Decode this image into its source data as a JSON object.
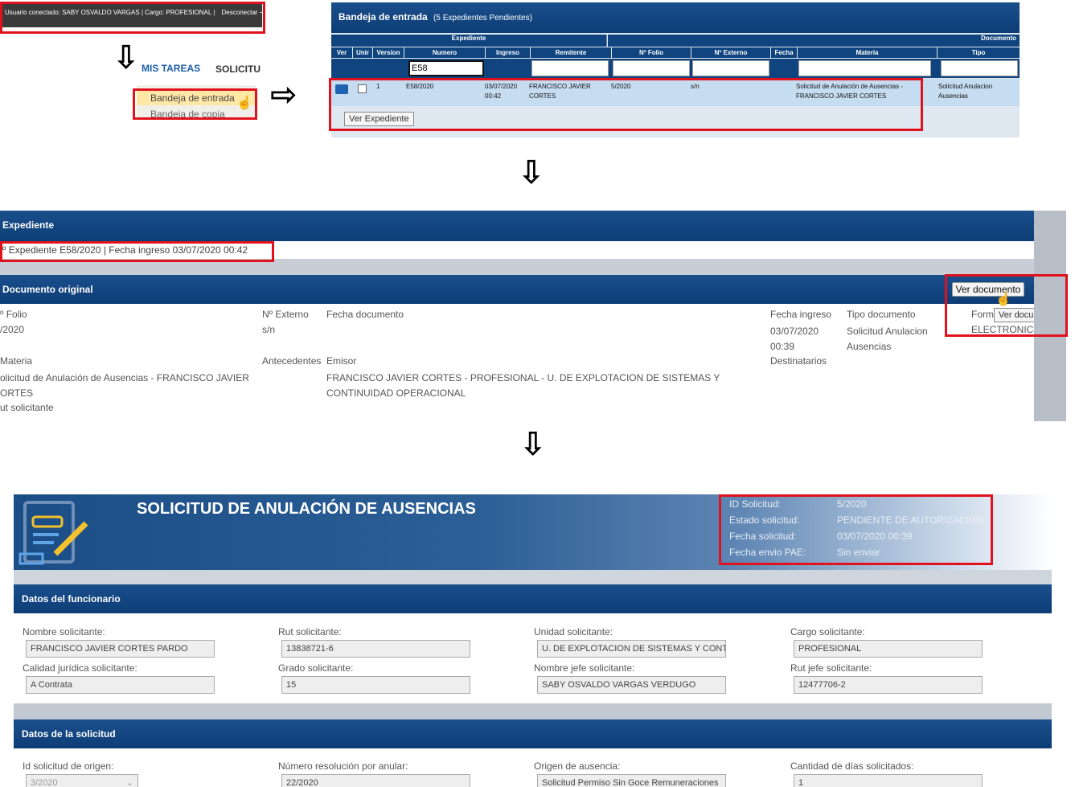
{
  "panel1": {
    "user_bar": "Usuario conectado: SABY OSVALDO VARGAS | Cargo: PROFESIONAL  |",
    "disconnect": "Desconectar",
    "mis_tareas": "MIS TAREAS",
    "solicitudes": "SOLICITU",
    "menu_items": [
      "Bandeja de entrada",
      "Bandeja de copia"
    ]
  },
  "panel2": {
    "title": "Bandeja de entrada",
    "subtitle": "(5 Expedientes Pendientes)",
    "group_expediente": "Expediente",
    "group_documento": "Documento",
    "columns": [
      "Ver",
      "Unir",
      "Version",
      "Numero",
      "Ingreso",
      "Remitente",
      "Nº Folio",
      "Nº Externo",
      "Fecha",
      "Materia",
      "Tipo"
    ],
    "filter_numero": "E58",
    "row": {
      "version": "1",
      "numero": "E58/2020",
      "ingreso": "03/07/2020 00:42",
      "remitente": "FRANCISCO JAVIER CORTES",
      "folio": "5/2020",
      "externo": "s/n",
      "materia": "Solicitud de Anulación de Ausencias - FRANCISCO JAVIER CORTES",
      "tipo": "Solicitud Anulacion Ausencias"
    },
    "tooltip": "Ver Expediente"
  },
  "panel3": {
    "expediente_title": "Expediente",
    "expediente_info": "º Expediente E58/2020 | Fecha ingreso 03/07/2020 00:42",
    "doc_title": "Documento original",
    "ver_documento": "Ver documento",
    "tooltip": "Ver documento",
    "folio_label": "º Folio",
    "folio_value": "/2020",
    "externo_label": "Nº Externo",
    "externo_value": "s/n",
    "fecha_doc_label": "Fecha documento",
    "fecha_ingreso_label": "Fecha ingreso",
    "fecha_ingreso_value": "03/07/2020 00:39",
    "tipo_doc_label": "Tipo documento",
    "tipo_doc_value": "Solicitud Anulacion Ausencias",
    "formato_label": "Form",
    "formato_value": "ELECTRONICO",
    "materia_label": "Materia",
    "materia_value": "olicitud de Anulación de Ausencias - FRANCISCO JAVIER ORTES",
    "antecedentes_label": "Antecedentes",
    "emisor_label": "Emisor",
    "emisor_value": "FRANCISCO JAVIER CORTES - PROFESIONAL - U. DE EXPLOTACION DE SISTEMAS Y CONTINUIDAD OPERACIONAL",
    "destinatarios_label": "Destinatarios",
    "rut_label": "ut solicitante"
  },
  "panel4": {
    "title": "SOLICITUD DE ANULACIÓN DE AUSENCIAS",
    "info": [
      {
        "label": "ID Solicitud:",
        "value": "5/2020"
      },
      {
        "label": "Estado solicitud:",
        "value": "PENDIENTE DE AUTORIZACION"
      },
      {
        "label": "Fecha solicitud:",
        "value": "03/07/2020 00:39"
      },
      {
        "label": "Fecha envio PAE:",
        "value": "Sin enviar"
      }
    ],
    "section1": "Datos del funcionario",
    "fields1": [
      {
        "label": "Nombre solicitante:",
        "value": "FRANCISCO JAVIER CORTES PARDO"
      },
      {
        "label": "Rut solicitante:",
        "value": "13838721-6"
      },
      {
        "label": "Unidad solicitante:",
        "value": "U. DE EXPLOTACION DE SISTEMAS Y CONT"
      },
      {
        "label": "Cargo solicitante:",
        "value": "PROFESIONAL"
      },
      {
        "label": "Calidad jurídica solicitante:",
        "value": "A Contrata"
      },
      {
        "label": "Grado solicitante:",
        "value": "15"
      },
      {
        "label": "Nombre jefe solicitante:",
        "value": "SABY OSVALDO VARGAS VERDUGO"
      },
      {
        "label": "Rut jefe solicitante:",
        "value": "12477706-2"
      }
    ],
    "section2": "Datos de la solicitud",
    "fields2": [
      {
        "label": "Id solicitud de origen:",
        "value": "3/2020"
      },
      {
        "label": "Número resolución por anular:",
        "value": "22/2020"
      },
      {
        "label": "Origen de ausencia:",
        "value": "Solicitud Permiso Sin Goce Remuneraciones"
      },
      {
        "label": "Cantidad de días solicitados:",
        "value": "1"
      }
    ]
  },
  "colors": {
    "header_blue": "#0d3d76",
    "highlight_red": "#e0121d",
    "row_blue": "#c6dcf1"
  }
}
